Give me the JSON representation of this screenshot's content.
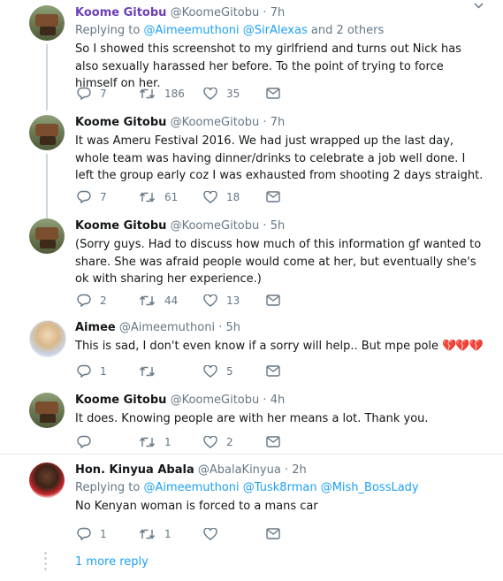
{
  "tweets": [
    {
      "name": "Koome Gitobu",
      "handle": "@KoomeGitobu",
      "time": "7h",
      "replying_prefix": "Replying to",
      "replying_to": [
        "@Aimeemuthoni",
        "@SirAlexas"
      ],
      "replying_suffix": "and 2 others",
      "text": "So I showed this screenshot to my girlfriend and turns out Nick has also sexually harassed her before. To the point of trying to force himself on her.",
      "replies": "7",
      "retweets": "186",
      "likes": "35"
    },
    {
      "name": "Koome Gitobu",
      "handle": "@KoomeGitobu",
      "time": "7h",
      "text": "It was Ameru Festival 2016. We had just wrapped up the last day, whole team was having dinner/drinks to celebrate a job well done. I left the group early coz I was exhausted from shooting 2 days straight.",
      "replies": "7",
      "retweets": "61",
      "likes": "18"
    },
    {
      "name": "Koome Gitobu",
      "handle": "@KoomeGitobu",
      "time": "5h",
      "text": "(Sorry guys. Had to discuss how much of this information gf wanted to share. She was afraid people would come at her, but eventually she's ok with sharing her experience.)",
      "replies": "2",
      "retweets": "44",
      "likes": "13"
    },
    {
      "name": "Aimee",
      "handle": "@Aimeemuthoni",
      "time": "5h",
      "text": "This is sad, I don't even know if a sorry will help.. But mpe pole",
      "hearts": "💔💔💔",
      "replies": "1",
      "retweets": "",
      "likes": "5"
    },
    {
      "name": "Koome Gitobu",
      "handle": "@KoomeGitobu",
      "time": "4h",
      "text": "It does. Knowing people are with her means a lot. Thank you.",
      "replies": "",
      "retweets": "1",
      "likes": "2"
    },
    {
      "name": "Hon. Kinyua Abala",
      "handle": "@AbalaKinyua",
      "time": "2h",
      "replying_prefix": "Replying to",
      "replying_to": [
        "@Aimeemuthoni",
        "@Tusk8rman",
        "@Mish_BossLady"
      ],
      "text": "No Kenyan woman is forced to a mans car",
      "replies": "1",
      "retweets": "1",
      "likes": ""
    }
  ],
  "separator": "·",
  "more_replies": "1 more reply",
  "icons": {
    "reply": "reply-icon",
    "retweet": "retweet-icon",
    "like": "heart-icon",
    "dm": "direct-message-icon",
    "caret": "chevron-down-icon"
  },
  "colors": {
    "link": "#1da1f2",
    "muted": "#657786",
    "highlight_name": "#6c3fb8",
    "broken_heart": "#d6243a"
  }
}
